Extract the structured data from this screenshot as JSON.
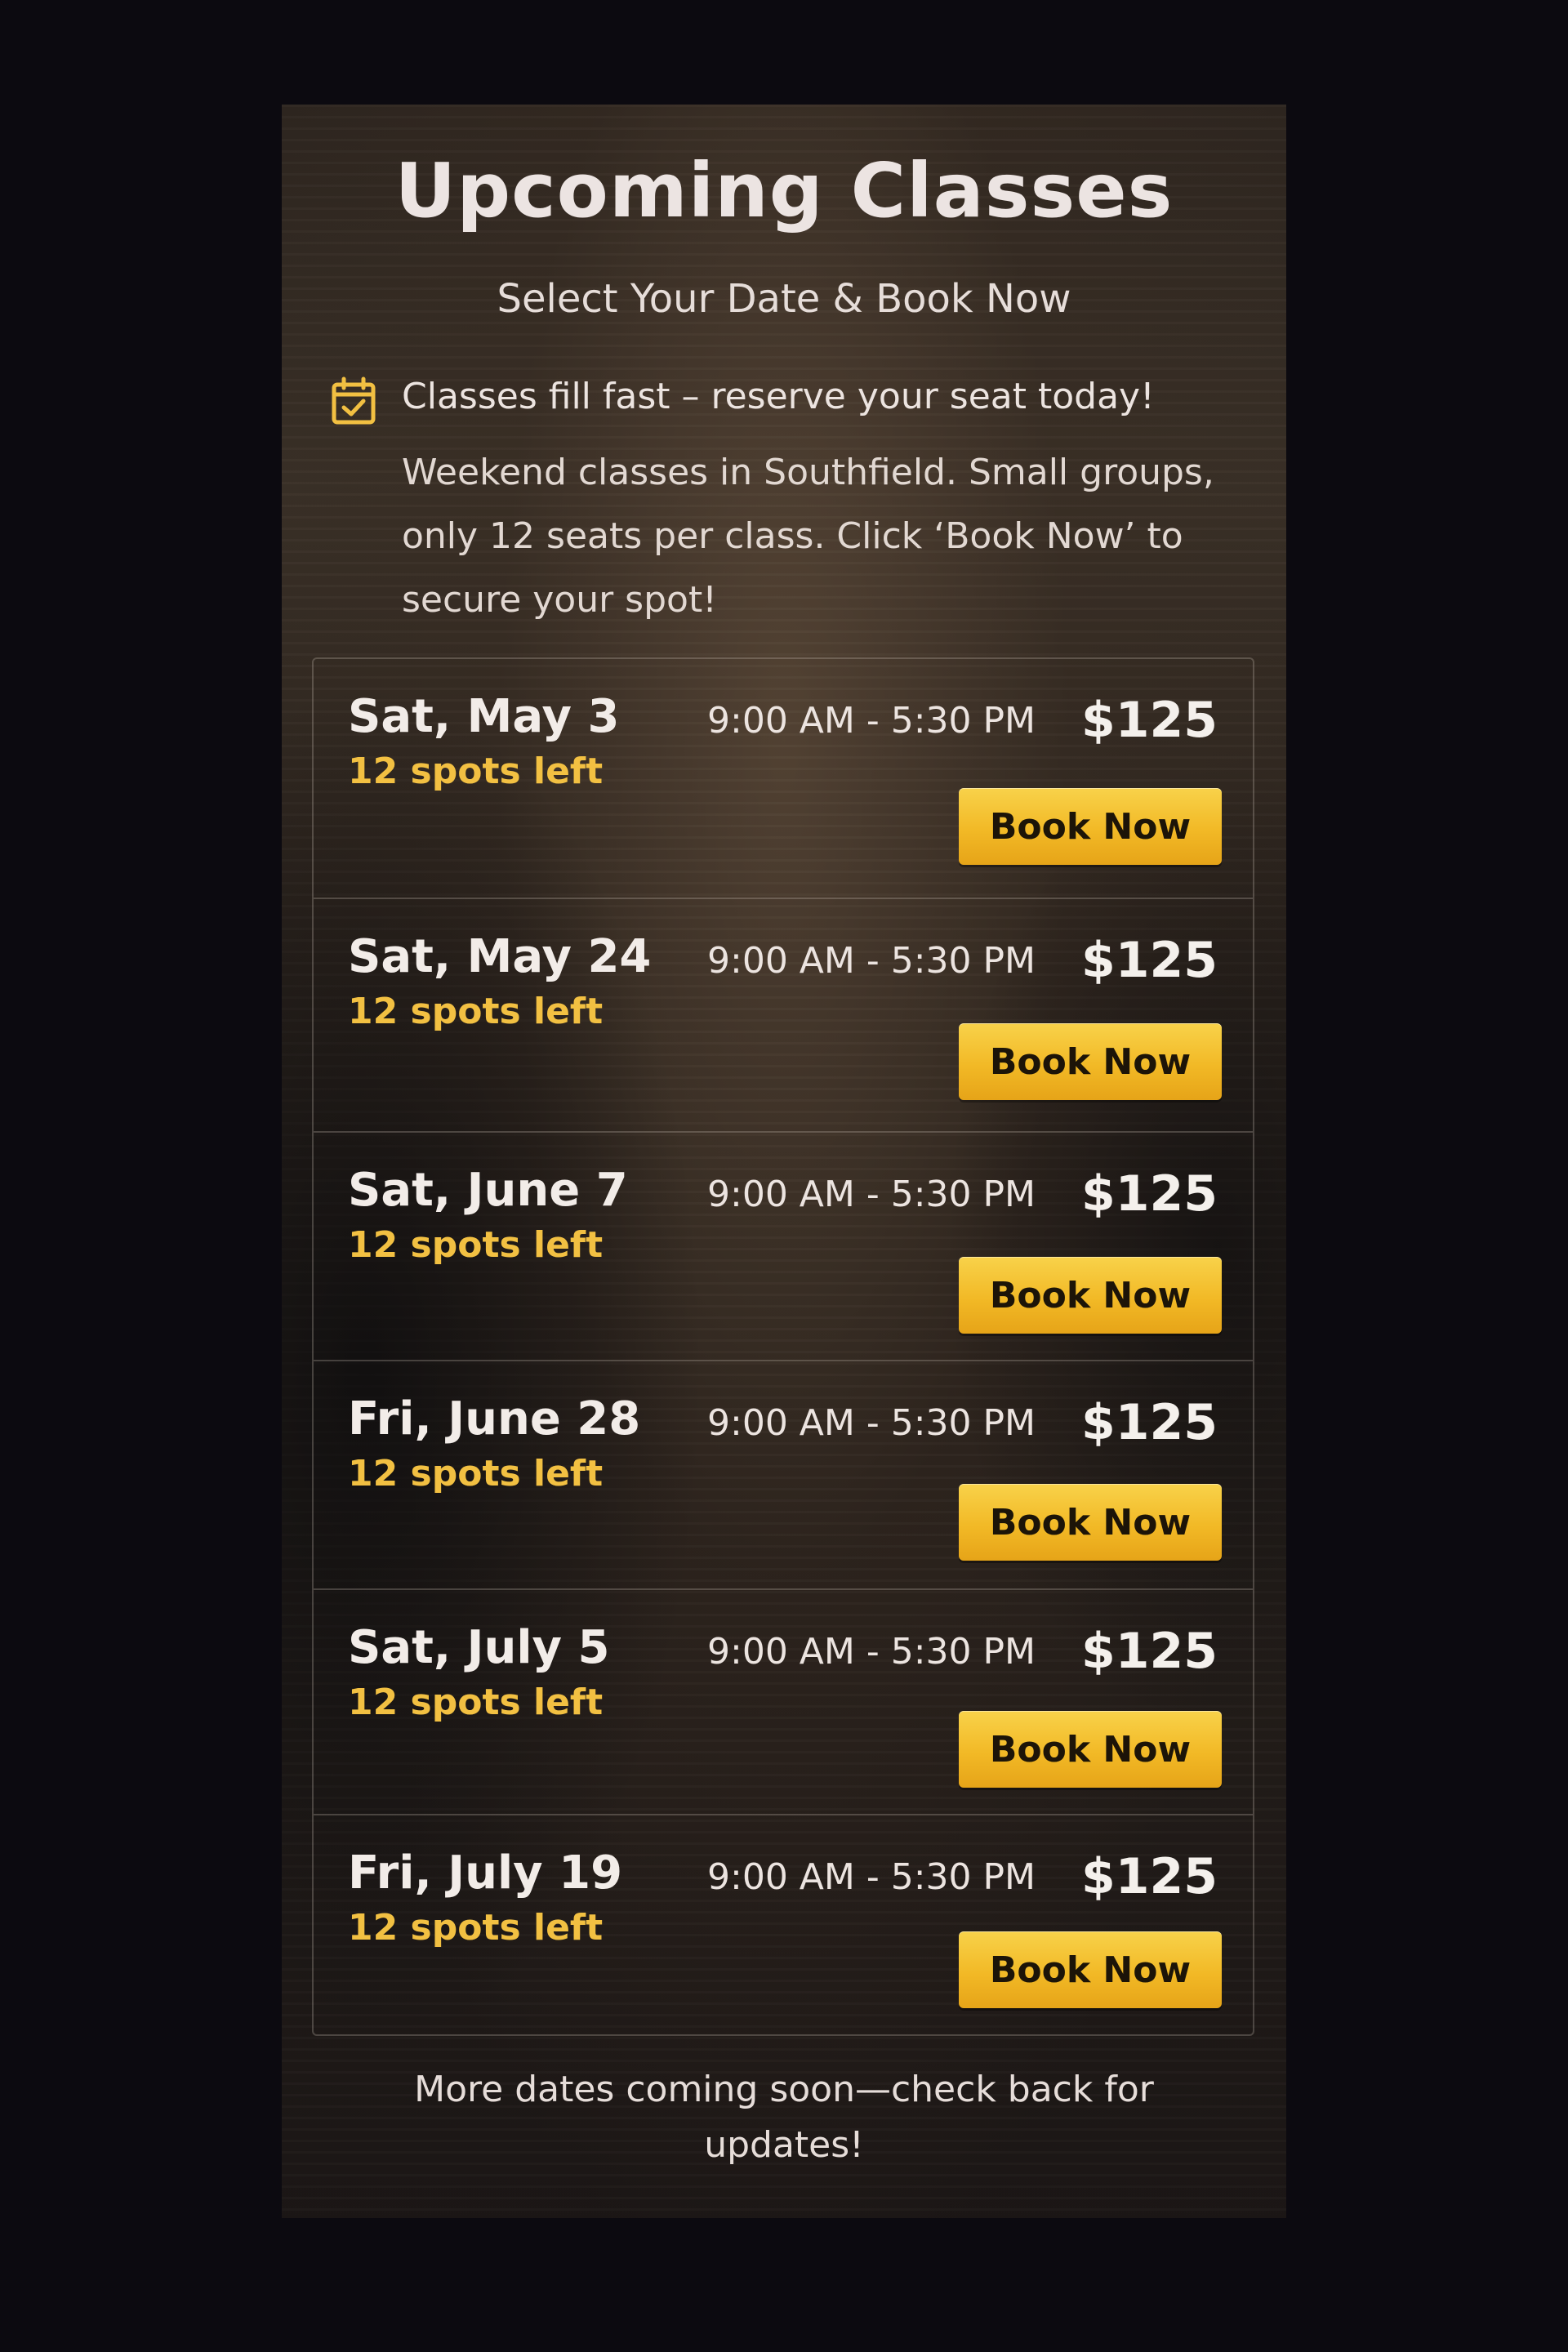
{
  "header": {
    "title": "Upcoming Classes",
    "subtitle": "Select Your Date & Book Now"
  },
  "notice": {
    "icon": "calendar-check-icon",
    "headline": "Classes fill fast – reserve your seat today!",
    "body": "Weekend classes in Southfield. Small groups, only 12 seats per class. Click ‘Book Now’ to secure your spot!"
  },
  "classes": [
    {
      "date": "Sat, May 3",
      "spots": "12 spots left",
      "time": "9:00 AM - 5:30 PM",
      "price": "$125",
      "button": "Book Now"
    },
    {
      "date": "Sat, May 24",
      "spots": "12 spots left",
      "time": "9:00 AM - 5:30 PM",
      "price": "$125",
      "button": "Book Now"
    },
    {
      "date": "Sat, June 7",
      "spots": "12 spots left",
      "time": "9:00 AM - 5:30 PM",
      "price": "$125",
      "button": "Book Now"
    },
    {
      "date": "Fri, June 28",
      "spots": "12 spots left",
      "time": "9:00 AM - 5:30 PM",
      "price": "$125",
      "button": "Book Now"
    },
    {
      "date": "Sat, July 5",
      "spots": "12 spots left",
      "time": "9:00 AM - 5:30 PM",
      "price": "$125",
      "button": "Book Now"
    },
    {
      "date": "Fri, July 19",
      "spots": "12 spots left",
      "time": "9:00 AM - 5:30 PM",
      "price": "$125",
      "button": "Book Now"
    }
  ],
  "footer": {
    "note": "More dates coming soon—check back for updates!"
  },
  "colors": {
    "accent": "#f2c042",
    "button": "#f2b926",
    "background": "#0c0a10"
  }
}
